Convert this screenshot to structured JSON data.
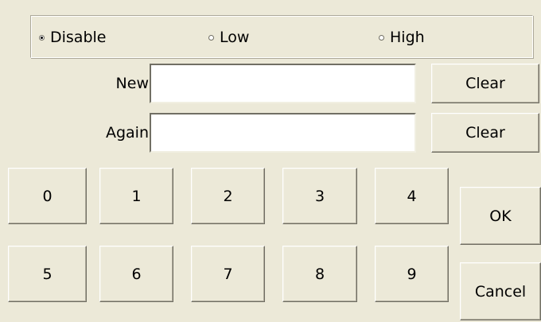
{
  "security_level": {
    "options": [
      {
        "label": "Disable",
        "checked": true
      },
      {
        "label": "Low",
        "checked": false
      },
      {
        "label": "High",
        "checked": false
      }
    ]
  },
  "password": {
    "new_label": "New",
    "new_value": "",
    "again_label": "Again",
    "again_value": "",
    "clear_new_label": "Clear",
    "clear_again_label": "Clear"
  },
  "keypad": {
    "keys": [
      "0",
      "1",
      "2",
      "3",
      "4",
      "5",
      "6",
      "7",
      "8",
      "9"
    ]
  },
  "actions": {
    "ok_label": "OK",
    "cancel_label": "Cancel"
  }
}
